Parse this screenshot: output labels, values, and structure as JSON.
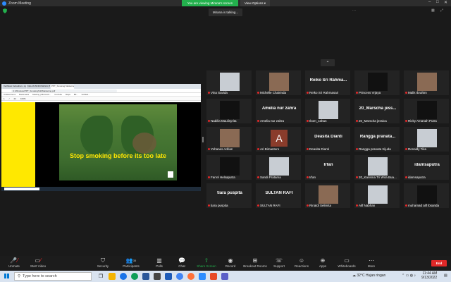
{
  "window": {
    "title": "Zoom Meeting",
    "share_banner": "You are viewing Mirana's screen",
    "view_options": "View Options",
    "talking": "Mirana is talking..."
  },
  "shared_screen": {
    "tabs": [
      "Verifikasi Kehadiran - Agenda P...",
      "KELAS BINDONESIA (BAHASA) - 88...",
      "PPT_Smoking Marketing.pdf"
    ],
    "url": "C:/Windows/PPT_Smoking%20Marketing.pdf",
    "bookmarks": [
      "Untitled Items",
      "Bookmarks",
      "Meeting | Microsoft...",
      "YouTube",
      "Maps",
      "Bb...",
      "Untitled..."
    ],
    "pdf_toolbar": [
      "1",
      "/",
      "24",
      "100%"
    ],
    "slide_text": "Stop smoking before its too late"
  },
  "participants": [
    {
      "name": "Vina Savida",
      "type": "video",
      "tone": "light"
    },
    {
      "name": "Michelle Chairinda",
      "type": "video",
      "tone": "brown"
    },
    {
      "name": "Reiko Sri Rahmasari",
      "type": "name",
      "big": "Reiko Sri Rahma..."
    },
    {
      "name": "Princess Vrjaya",
      "type": "video",
      "tone": "dark"
    },
    {
      "name": "Malik Ibrahim",
      "type": "video",
      "tone": "brown"
    },
    {
      "name": "Nabilla Maulisyrita",
      "type": "video",
      "tone": "dark"
    },
    {
      "name": "Amelia nur zahra",
      "type": "name",
      "big": "Amelia nur zahra"
    },
    {
      "name": "Ikom_zahan",
      "type": "video",
      "tone": "light"
    },
    {
      "name": "20_Marscha jessica",
      "type": "name",
      "big": "20_Marscha jess..."
    },
    {
      "name": "Rizky Amanah Putra",
      "type": "video",
      "tone": "dark"
    },
    {
      "name": "Yohanes Adrian",
      "type": "video",
      "tone": "brown"
    },
    {
      "name": "Ari Bimantoro",
      "type": "avatar",
      "letter": "A"
    },
    {
      "name": "Deasita Dianti",
      "type": "name",
      "big": "Deasita Dianti"
    },
    {
      "name": "Rangga pranata trijuda",
      "type": "name",
      "big": "Rangga  pranata..."
    },
    {
      "name": "Renaldy Tika",
      "type": "video",
      "tone": "light"
    },
    {
      "name": "Farrel Helsaputra",
      "type": "video",
      "tone": "dark"
    },
    {
      "name": "Sandi Pratama",
      "type": "video",
      "tone": "light"
    },
    {
      "name": "Irfan",
      "type": "name",
      "big": "Irfan"
    },
    {
      "name": "20_Karisma Tri Wira Bua...",
      "type": "video",
      "tone": "light"
    },
    {
      "name": "idamsaputra",
      "type": "name",
      "big": "idamsaputra"
    },
    {
      "name": "tiara puspita",
      "type": "name",
      "big": "tiara puspita"
    },
    {
      "name": "SULTAN RAFI",
      "type": "name",
      "big": "SULTAN RAFI"
    },
    {
      "name": "Rinaldi Selimita",
      "type": "video",
      "tone": "brown"
    },
    {
      "name": "Alif Nabhan",
      "type": "video",
      "tone": "light"
    },
    {
      "name": "muhamad alif ibsanda",
      "type": "video",
      "tone": "dark"
    }
  ],
  "toolbar": {
    "unmute": "Unmute",
    "start_video": "Start Video",
    "security": "Security",
    "participants": "Participants",
    "participants_count": "35",
    "polls": "Polls",
    "chat": "Chat",
    "share_screen": "Share Screen",
    "record": "Record",
    "breakout": "Breakout Rooms",
    "support": "Support",
    "reactions": "Reactions",
    "apps": "Apps",
    "whiteboards": "Whiteboards",
    "more": "More",
    "end": "End"
  },
  "taskbar": {
    "search_placeholder": "Type here to search",
    "weather": "32°C  Hujan ringan",
    "time": "11:44 AM",
    "date": "9/13/2022"
  },
  "colors": {
    "accent_green": "#23b14d",
    "end_red": "#e02828",
    "slide_text": "#ffe600",
    "side_yellow": "#ffe800"
  }
}
